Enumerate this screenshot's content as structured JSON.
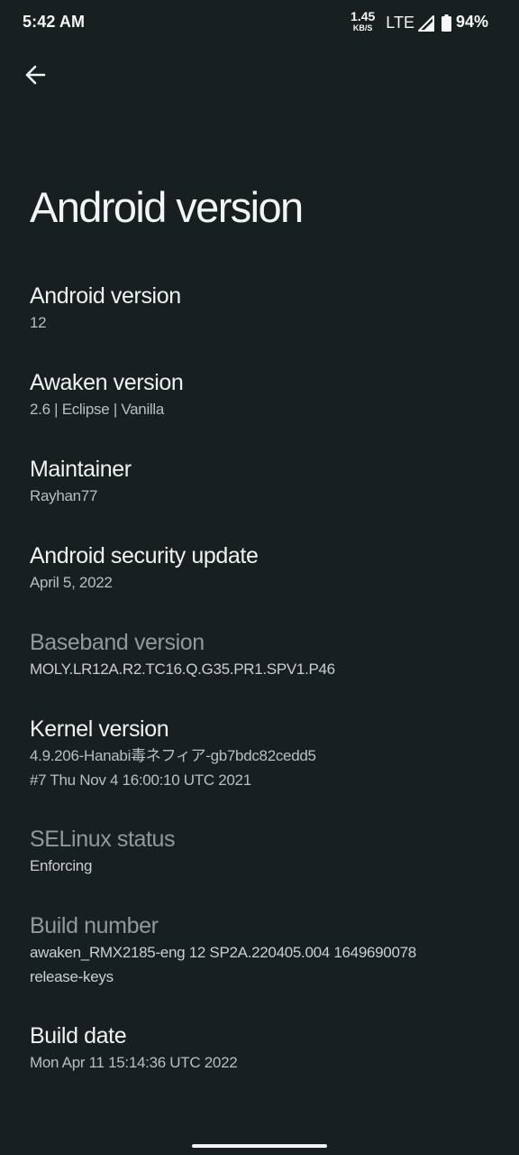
{
  "status_bar": {
    "time": "5:42 AM",
    "net_speed_value": "1.45",
    "net_speed_unit": "KB/S",
    "network_type": "LTE",
    "battery_percent": "94%",
    "signal_icon": "signal-icon",
    "battery_icon": "battery-icon"
  },
  "toolbar": {
    "back_icon": "arrow-back-icon"
  },
  "page": {
    "title": "Android version"
  },
  "items": [
    {
      "title": "Android version",
      "summary": "12",
      "enabled": true
    },
    {
      "title": "Awaken version",
      "summary": "2.6 | Eclipse | Vanilla",
      "enabled": true
    },
    {
      "title": "Maintainer",
      "summary": "Rayhan77",
      "enabled": true
    },
    {
      "title": "Android security update",
      "summary": "April 5, 2022",
      "enabled": true
    },
    {
      "title": "Baseband version",
      "summary": "MOLY.LR12A.R2.TC16.Q.G35.PR1.SPV1.P46",
      "enabled": false
    },
    {
      "title": "Kernel version",
      "summary_line1": "4.9.206-Hanabi毒ネフィア-gb7bdc82cedd5",
      "summary_line2": "#7 Thu Nov 4 16:00:10 UTC 2021",
      "enabled": true
    },
    {
      "title": "SELinux status",
      "summary": "Enforcing",
      "enabled": false
    },
    {
      "title": "Build number",
      "summary_line1": "awaken_RMX2185-eng 12 SP2A.220405.004 1649690078",
      "summary_line2": "release-keys",
      "enabled": false
    },
    {
      "title": "Build date",
      "summary": "Mon Apr 11 15:14:36 UTC 2022",
      "enabled": true
    }
  ],
  "colors": {
    "background": "#171f20",
    "text_primary": "#eef2f2",
    "text_secondary": "#b7bfc0",
    "text_disabled": "#8f9a9b"
  }
}
